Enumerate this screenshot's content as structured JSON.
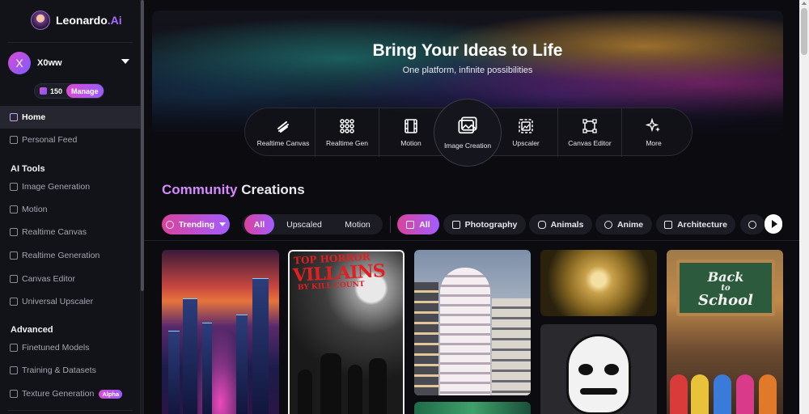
{
  "brand": {
    "name": "Leonardo",
    "suffix": ".Ai"
  },
  "user": {
    "initial": "X",
    "name": "X0ww"
  },
  "tokens": {
    "count": "150",
    "manage_label": "Manage"
  },
  "nav": {
    "home": "Home",
    "personal_feed": "Personal Feed",
    "ai_tools_title": "AI Tools",
    "ai_tools": [
      "Image Generation",
      "Motion",
      "Realtime Canvas",
      "Realtime Generation",
      "Canvas Editor",
      "Universal Upscaler"
    ],
    "advanced_title": "Advanced",
    "advanced": [
      "Finetuned Models",
      "Training & Datasets",
      "Texture Generation"
    ],
    "alpha_badge": "Alpha"
  },
  "hero": {
    "title": "Bring Your Ideas to Life",
    "subtitle": "One platform, infinite possibilities"
  },
  "tools": [
    {
      "label": "Realtime Canvas",
      "icon": "brush-stroke-icon"
    },
    {
      "label": "Realtime Gen",
      "icon": "dots-grid-icon"
    },
    {
      "label": "Motion",
      "icon": "film-icon"
    },
    {
      "label": "Image Creation",
      "icon": "images-icon"
    },
    {
      "label": "Upscaler",
      "icon": "upscale-icon"
    },
    {
      "label": "Canvas Editor",
      "icon": "canvas-icon"
    },
    {
      "label": "More",
      "icon": "sparkles-icon"
    }
  ],
  "community": {
    "word1": "Community",
    "word2": "Creations"
  },
  "filters": {
    "trending": "Trending",
    "type_tabs": [
      "All",
      "Upscaled",
      "Motion"
    ],
    "categories": [
      "All",
      "Photography",
      "Animals",
      "Anime",
      "Architecture"
    ]
  },
  "gallery": {
    "card2": {
      "line1": "TOP HORROR",
      "line2": "VILLAINS",
      "line3": "BY KILL COUNT"
    },
    "card6": {
      "line1": "Back",
      "line2": "to",
      "line3": "School"
    }
  },
  "colors": {
    "accent_pink": "#d9439c",
    "accent_purple": "#a35cff",
    "background": "#0b0b10"
  }
}
